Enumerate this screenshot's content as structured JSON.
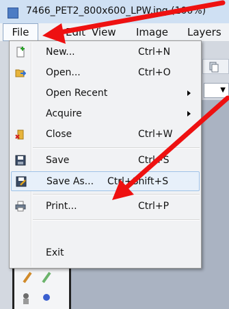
{
  "window": {
    "title": "7466_PET2_800x600_LPW.jpg (100%)"
  },
  "menubar": {
    "file": "File",
    "edit": "Edit",
    "view": "View",
    "image": "Image",
    "layers": "Layers"
  },
  "file_menu": {
    "items": [
      {
        "label": "New...",
        "shortcut": "Ctrl+N",
        "icon": "new-document-icon"
      },
      {
        "label": "Open...",
        "shortcut": "Ctrl+O",
        "icon": "open-folder-icon"
      },
      {
        "label": "Open Recent",
        "shortcut": "",
        "submenu": true
      },
      {
        "label": "Acquire",
        "shortcut": "",
        "submenu": true
      },
      {
        "label": "Close",
        "shortcut": "Ctrl+W",
        "icon": "close-folder-icon"
      },
      {
        "label": "Save",
        "shortcut": "Ctrl+S",
        "icon": "save-disk-icon"
      },
      {
        "label": "Save As...",
        "shortcut": "Ctrl+Shift+S",
        "icon": "save-as-icon",
        "highlighted": true
      },
      {
        "label": "Print...",
        "shortcut": "Ctrl+P",
        "icon": "printer-icon"
      },
      {
        "label": "Exit",
        "shortcut": ""
      }
    ]
  },
  "annotation": {
    "arrow_color": "#ee1111"
  },
  "colors": {
    "highlight_bg": "#e7f0fa",
    "highlight_border": "#9ec2e8",
    "menu_bg": "#f1f2f4"
  }
}
